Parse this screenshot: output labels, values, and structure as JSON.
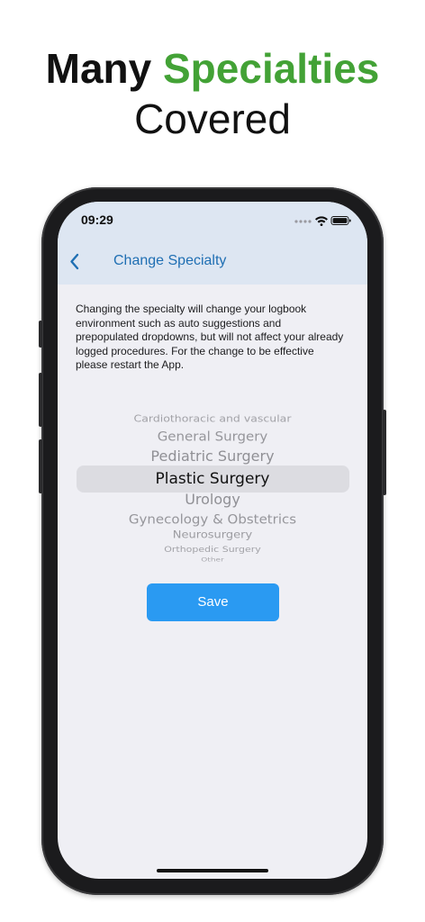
{
  "headline": {
    "word1": "Many",
    "word2": "Specialties",
    "line2": "Covered",
    "accent_color": "#43a236"
  },
  "status_bar": {
    "time": "09:29",
    "icons": [
      "cellular-dots-icon",
      "wifi-icon",
      "battery-icon"
    ]
  },
  "nav": {
    "back_icon": "chevron-left-icon",
    "title": "Change Specialty",
    "title_color": "#1f6fb3"
  },
  "description": "Changing the specialty will change your logbook environment such as auto suggestions and prepopulated dropdowns, but will not affect your already logged procedures. For the change to be effective please restart the App.",
  "picker": {
    "selected": "Plastic Surgery",
    "items": [
      "Cardiothoracic and vascular",
      "General Surgery",
      "Pediatric Surgery",
      "Plastic Surgery",
      "Urology",
      "Gynecology & Obstetrics",
      "Neurosurgery",
      "Orthopedic Surgery",
      "Other"
    ]
  },
  "save_button": {
    "label": "Save",
    "color": "#2a9af2"
  }
}
